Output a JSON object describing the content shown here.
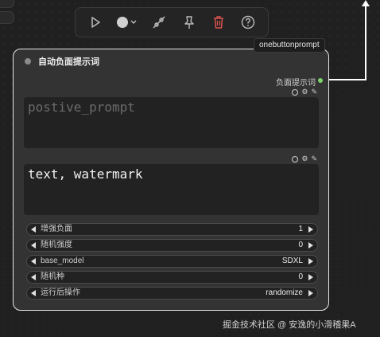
{
  "toolbar": {
    "buttons": [
      {
        "name": "play-button",
        "icon": "play-icon"
      },
      {
        "name": "color-button",
        "icon": "color-circle-icon"
      },
      {
        "name": "bypass-button",
        "icon": "bypass-icon"
      },
      {
        "name": "pin-button",
        "icon": "pin-icon"
      },
      {
        "name": "delete-button",
        "icon": "trash-icon"
      },
      {
        "name": "help-button",
        "icon": "help-icon"
      }
    ],
    "delete_color": "#d9534f"
  },
  "node": {
    "tag": "onebuttonprompt",
    "title": "自动负面提示词",
    "output_label": "负面提示词",
    "output_color": "#7bd36a",
    "positive_placeholder": "postive_prompt",
    "negative_text": "text, watermark",
    "widgets": [
      {
        "label": "增强负面",
        "value": "1"
      },
      {
        "label": "随机强度",
        "value": "0"
      },
      {
        "label": "base_model",
        "value": "SDXL"
      },
      {
        "label": "随机种",
        "value": "0"
      },
      {
        "label": "运行后操作",
        "value": "randomize"
      }
    ]
  },
  "watermark": "掘金技术社区 @ 安逸的小滑稽果A"
}
